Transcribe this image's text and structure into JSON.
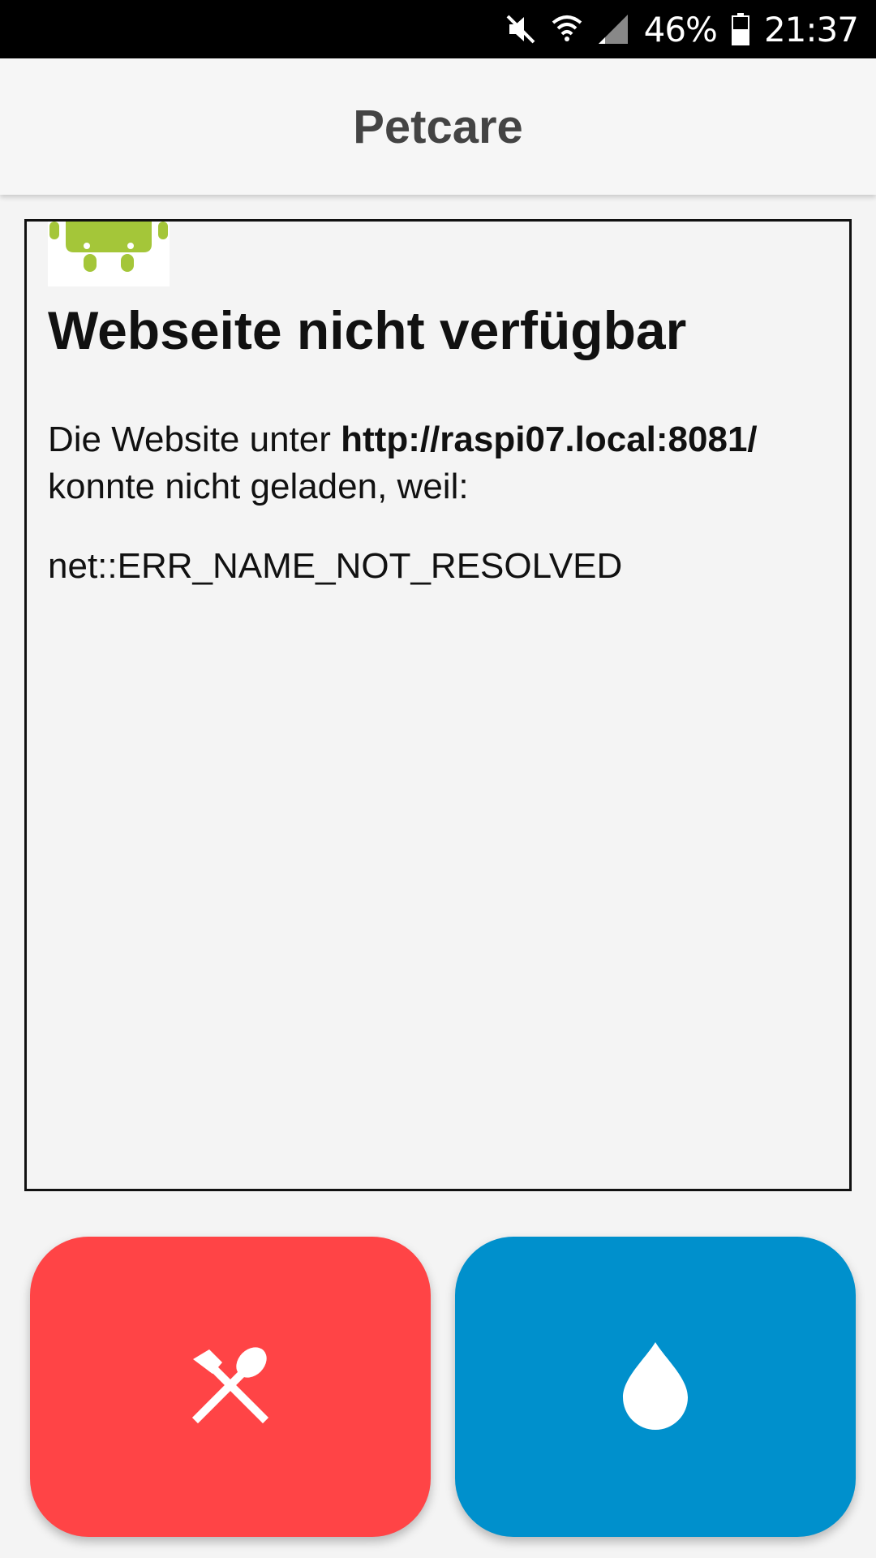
{
  "status_bar": {
    "battery_percent": "46%",
    "time": "21:37",
    "icons": [
      "mute-icon",
      "wifi-icon",
      "cell-signal-icon",
      "battery-icon"
    ]
  },
  "app_bar": {
    "title": "Petcare"
  },
  "webview": {
    "error_title": "Webseite nicht verfügbar",
    "message_prefix": "Die Website unter ",
    "url": "http://raspi07.local:8081/",
    "message_suffix": "konnte nicht geladen, weil:",
    "error_code": "net::ERR_NAME_NOT_RESOLVED",
    "logo_icon": "android-icon"
  },
  "actions": {
    "feed": {
      "icon": "fork-spoon-icon",
      "color": "#ff4446"
    },
    "water": {
      "icon": "water-drop-icon",
      "color": "#0090cc"
    }
  }
}
